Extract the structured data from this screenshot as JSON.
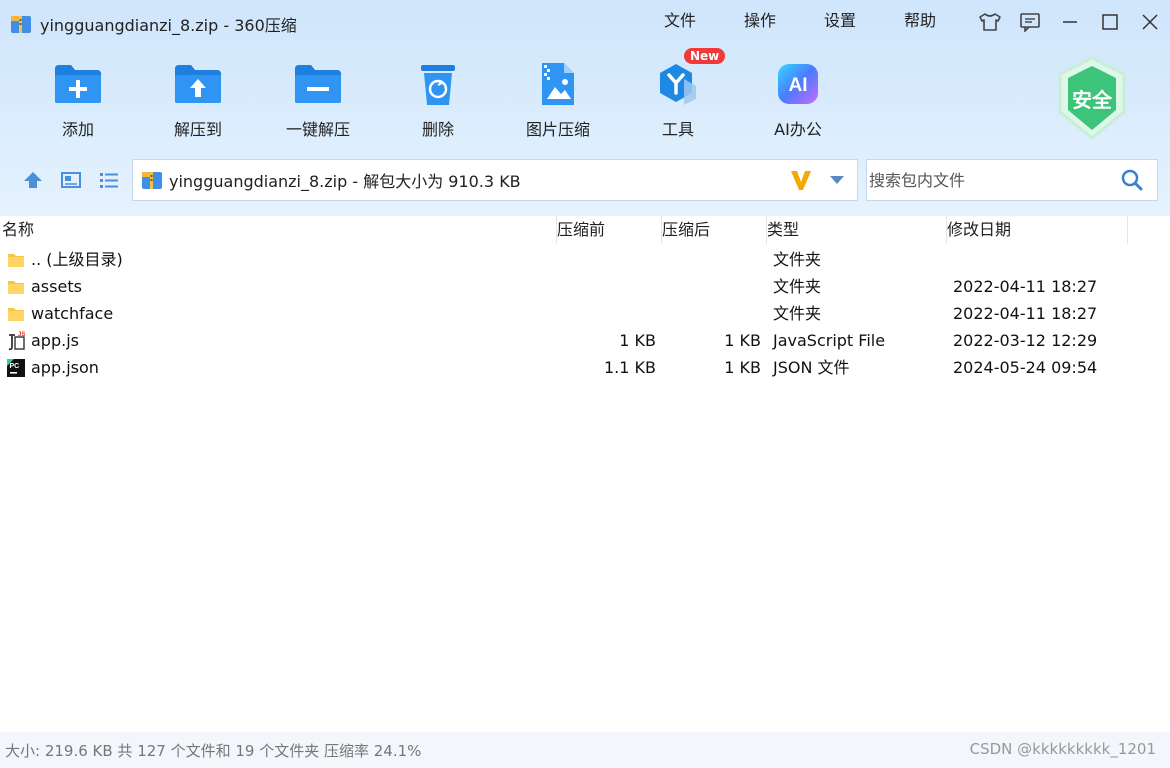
{
  "window": {
    "title": "yingguangdianzi_8.zip - 360压缩",
    "menu": [
      "文件",
      "操作",
      "设置",
      "帮助"
    ]
  },
  "toolbar": {
    "items": [
      {
        "label": "添加",
        "icon": "add-folder-icon"
      },
      {
        "label": "解压到",
        "icon": "extract-folder-icon"
      },
      {
        "label": "一键解压",
        "icon": "one-click-extract-icon"
      },
      {
        "label": "删除",
        "icon": "trash-icon"
      },
      {
        "label": "图片压缩",
        "icon": "image-compress-icon"
      },
      {
        "label": "工具",
        "icon": "tools-icon",
        "badge": "New"
      },
      {
        "label": "AI办公",
        "icon": "ai-office-icon"
      }
    ],
    "safe_label": "安全"
  },
  "address": {
    "text": "yingguangdianzi_8.zip - 解包大小为 910.3 KB"
  },
  "search": {
    "placeholder": "搜索包内文件"
  },
  "columns": {
    "name": "名称",
    "before": "压缩前",
    "after": "压缩后",
    "type": "类型",
    "date": "修改日期"
  },
  "files": [
    {
      "name": ".. (上级目录)",
      "before": "",
      "after": "",
      "type": "文件夹",
      "date": "",
      "icon": "folder-icon"
    },
    {
      "name": "assets",
      "before": "",
      "after": "",
      "type": "文件夹",
      "date": "2022-04-11 18:27",
      "icon": "folder-icon"
    },
    {
      "name": "watchface",
      "before": "",
      "after": "",
      "type": "文件夹",
      "date": "2022-04-11 18:27",
      "icon": "folder-icon"
    },
    {
      "name": "app.js",
      "before": "1 KB",
      "after": "1 KB",
      "type": "JavaScript File",
      "date": "2022-03-12 12:29",
      "icon": "js-file-icon"
    },
    {
      "name": "app.json",
      "before": "1.1 KB",
      "after": "1 KB",
      "type": "JSON 文件",
      "date": "2024-05-24 09:54",
      "icon": "pycharm-file-icon"
    }
  ],
  "status": {
    "summary": "大小: 219.6 KB 共 127 个文件和 19 个文件夹 压缩率 24.1%",
    "watermark": "CSDN @kkkkkkkkk_1201"
  },
  "colors": {
    "header_bg": "#d8ebfd",
    "accent_blue": "#1e88e5",
    "new_badge": "#f03a3a",
    "safe_green": "#3cc47a"
  }
}
